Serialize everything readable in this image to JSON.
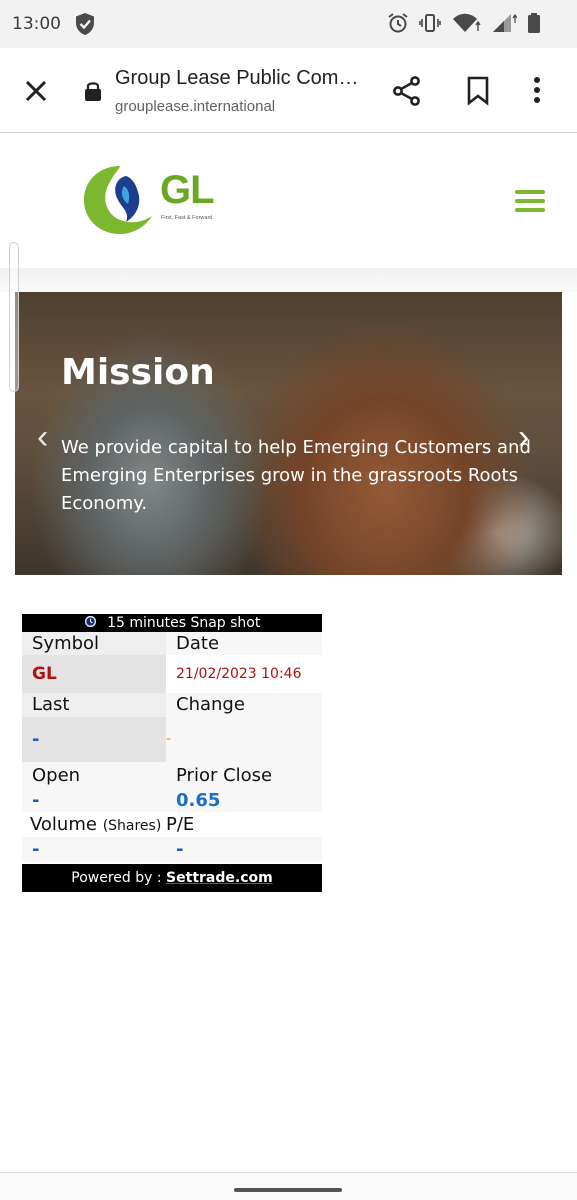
{
  "status_bar": {
    "time": "13:00"
  },
  "toolbar": {
    "title": "Group Lease Public Com…",
    "url": "grouplease.international"
  },
  "header": {
    "logo_text": "GL",
    "logo_tagline": "First, Fast & Forward"
  },
  "hero": {
    "title": "Mission",
    "text": "We provide capital to help Emerging Customers and Emerging Enterprises grow in the grassroots Roots Economy."
  },
  "stock": {
    "header": "15 minutes Snap shot",
    "symbol_label": "Symbol",
    "date_label": "Date",
    "symbol": "GL",
    "date": "21/02/2023 10:46",
    "last_label": "Last",
    "change_label": "Change",
    "last": "-",
    "change": "-",
    "open_label": "Open",
    "prior_close_label": "Prior Close",
    "open": "-",
    "prior_close": "0.65",
    "volume_label": "Volume",
    "volume_unit": "(Shares)",
    "pe_label": "P/E",
    "volume": "-",
    "pe": "-",
    "powered_by": "Powered by :",
    "powered_by_link": "Settrade.com"
  },
  "colors": {
    "brand_green": "#7cb82f",
    "symbol_red": "#b30f0f",
    "value_blue": "#1a6fc4"
  }
}
